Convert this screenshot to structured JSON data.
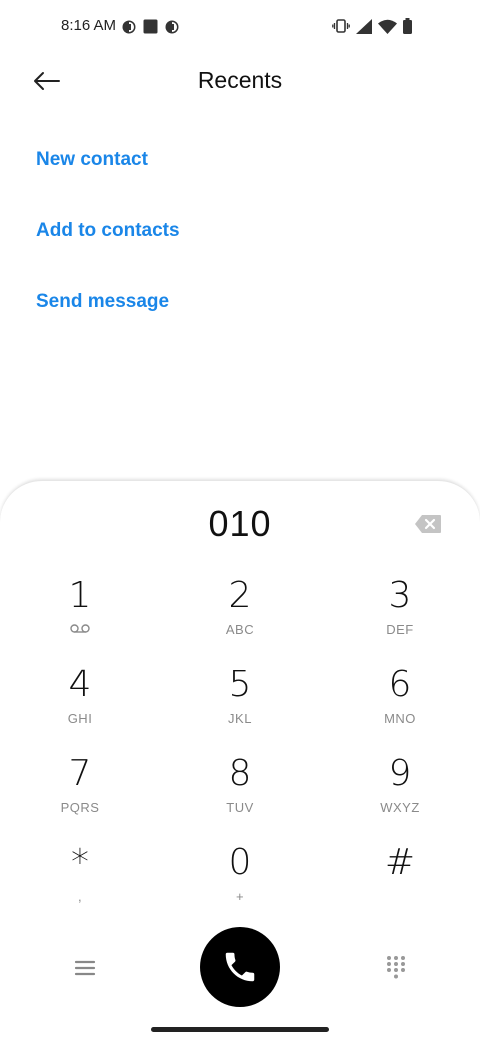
{
  "status_bar": {
    "time": "8:16 AM",
    "left_icons": [
      "notification-icon-1",
      "notification-square-icon",
      "notification-icon-2"
    ],
    "right_icons": [
      "vibrate-icon",
      "cell-signal-icon",
      "wifi-icon",
      "battery-icon"
    ]
  },
  "header": {
    "title": "Recents",
    "back_icon": "back-arrow-icon"
  },
  "actions": [
    {
      "label": "New contact"
    },
    {
      "label": "Add to contacts"
    },
    {
      "label": "Send message"
    }
  ],
  "dialer": {
    "number": "010",
    "backspace_icon": "backspace-icon",
    "keys": [
      {
        "digit": "1",
        "letters": "",
        "icon": "voicemail-icon"
      },
      {
        "digit": "2",
        "letters": "ABC"
      },
      {
        "digit": "3",
        "letters": "DEF"
      },
      {
        "digit": "4",
        "letters": "GHI"
      },
      {
        "digit": "5",
        "letters": "JKL"
      },
      {
        "digit": "6",
        "letters": "MNO"
      },
      {
        "digit": "7",
        "letters": "PQRS"
      },
      {
        "digit": "8",
        "letters": "TUV"
      },
      {
        "digit": "9",
        "letters": "WXYZ"
      },
      {
        "digit": "*",
        "letters": ","
      },
      {
        "digit": "0",
        "letters": "+"
      },
      {
        "digit": "#",
        "letters": ""
      }
    ],
    "bottom_icons": {
      "menu": "menu-icon",
      "call": "phone-icon",
      "dialpad": "dialpad-icon"
    }
  },
  "colors": {
    "accent": "#1a86e8",
    "call_button": "#000000",
    "key_letters": "#8a8a8a"
  }
}
